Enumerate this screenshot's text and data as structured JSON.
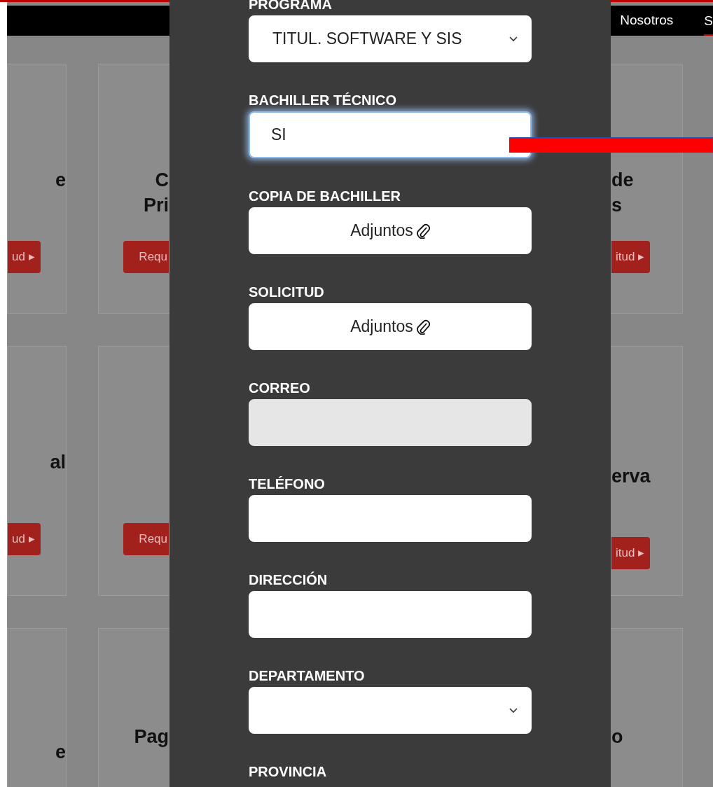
{
  "nav": {
    "items": [
      {
        "label": "Nosotros",
        "selected": false
      },
      {
        "label": "S",
        "selected": true
      }
    ]
  },
  "cards": [
    {
      "title": [
        "e"
      ],
      "buttons": [
        {
          "label": "ud ▸"
        }
      ]
    },
    {
      "title": [
        "C",
        "Pri"
      ],
      "buttons": [
        {
          "label": "Requ"
        }
      ]
    },
    {
      "title": [
        "de",
        "s"
      ],
      "buttons": [
        {
          "label": "itud ▸"
        }
      ]
    },
    {
      "title": [
        "al"
      ],
      "buttons": [
        {
          "label": "ud ▸"
        }
      ]
    },
    {
      "buttons": [
        {
          "label": "Requ"
        }
      ]
    },
    {
      "title": [
        "erva"
      ],
      "buttons": [
        {
          "label": "itud ▸"
        }
      ]
    },
    {
      "title": [
        "e"
      ]
    },
    {
      "title": [
        "Pag"
      ]
    },
    {
      "title": [
        "o"
      ]
    }
  ],
  "form": {
    "fields": [
      {
        "label": "PROGRAMA",
        "kind": "select",
        "value": "TITUL. SOFTWARE Y SIS",
        "focused": false,
        "disabled": false
      },
      {
        "label": "BACHILLER TÉCNICO",
        "kind": "text",
        "value": "SI",
        "focused": true,
        "disabled": false
      },
      {
        "label": "COPIA DE BACHILLER",
        "kind": "attachment",
        "value": "Adjuntos",
        "focused": false,
        "disabled": false
      },
      {
        "label": "SOLICITUD",
        "kind": "attachment",
        "value": "Adjuntos",
        "focused": false,
        "disabled": false
      },
      {
        "label": "CORREO",
        "kind": "text",
        "focused": false,
        "disabled": true
      },
      {
        "label": "TELÉFONO",
        "kind": "text",
        "focused": false,
        "disabled": false
      },
      {
        "label": "DIRECCIÓN",
        "kind": "text",
        "focused": false,
        "disabled": false
      },
      {
        "label": "DEPARTAMENTO",
        "kind": "select",
        "focused": false,
        "disabled": false
      },
      {
        "label": "PROVINCIA",
        "kind": "label"
      }
    ]
  }
}
